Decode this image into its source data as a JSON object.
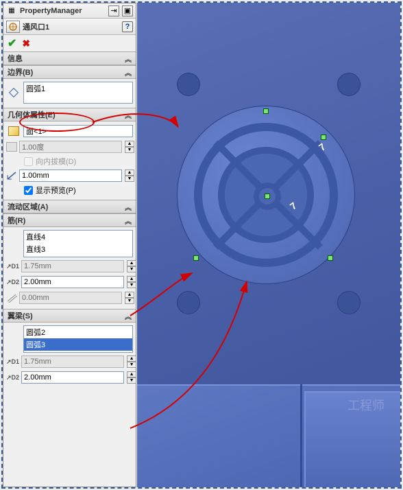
{
  "header": {
    "title": "PropertyManager"
  },
  "feature": {
    "name": "通风口1"
  },
  "sections": {
    "info": {
      "title": "信息"
    },
    "boundary": {
      "title": "边界(B)",
      "selection": "圆弧1"
    },
    "geom": {
      "title": "几何体属性(E)",
      "face": "面<1>",
      "draft": "1.00度",
      "draft_inward_label": "向内拔模(D)",
      "depth": "1.00mm",
      "preview_label": "显示预览(P)",
      "preview_checked": true
    },
    "flow": {
      "title": "流动区域(A)"
    },
    "ribs": {
      "title": "筋(R)",
      "items": [
        "直线4",
        "直线3"
      ],
      "d1": "1.75mm",
      "d2": "2.00mm",
      "off": "0.00mm"
    },
    "spars": {
      "title": "翼梁(S)",
      "items": [
        "圆弧2",
        "圆弧3"
      ],
      "selected_index": 1,
      "d1": "1.75mm",
      "d2": "2.00mm"
    }
  },
  "viewport": {
    "dim1": "7",
    "dim2": "7",
    "watermark": "工程师"
  }
}
